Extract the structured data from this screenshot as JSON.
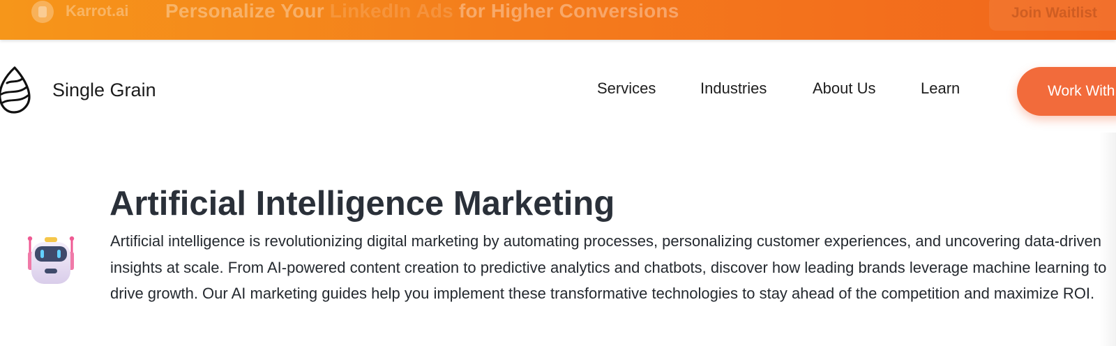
{
  "promo": {
    "brand": "Karrot.ai",
    "headline_start": "Personalize Your ",
    "headline_mid": "LinkedIn Ads",
    "headline_end": " for Higher Conversions",
    "button_label": "Join Waitlist"
  },
  "nav": {
    "brand_name": "Single Grain",
    "links": [
      "Services",
      "Industries",
      "About Us",
      "Learn"
    ],
    "cta_label": "Work With Us"
  },
  "hero": {
    "title": "Artificial Intelligence Marketing",
    "intro": "Artificial intelligence is revolutionizing digital marketing by automating processes, personalizing customer experiences, and uncovering data-driven insights at scale. From AI-powered content creation to predictive analytics and chatbots, discover how leading brands leverage machine learning to drive growth. Our AI marketing guides help you implement these transformative technologies to stay ahead of the competition and maximize ROI."
  },
  "icons": {
    "promo_logo": "karrot-logo-icon",
    "brand_logo": "single-grain-logo-icon",
    "category": "robot-icon"
  },
  "colors": {
    "banner_start": "#f6961a",
    "banner_end": "#f2661c",
    "cta": "#f26b3b",
    "title": "#2a3039"
  }
}
